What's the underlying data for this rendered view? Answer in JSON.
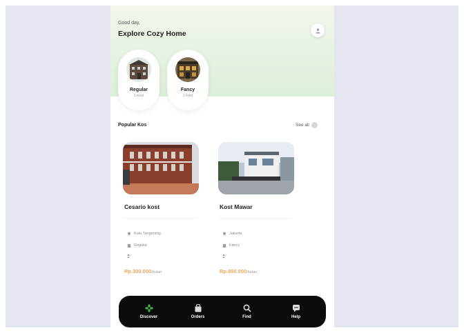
{
  "header": {
    "greeting": "Good day,",
    "title": "Explore Cozy Home"
  },
  "categories": [
    {
      "name": "Regular",
      "count": "1 kost"
    },
    {
      "name": "Fancy",
      "count": "1 kost"
    }
  ],
  "popular": {
    "title": "Popular Kos",
    "see_all": "See all"
  },
  "listings": [
    {
      "name": "Cesario kost",
      "location": "Kota Tangerang",
      "category": "Regular",
      "price": "Rp.300.000",
      "per": "/bulan"
    },
    {
      "name": "Kost Mawar",
      "location": "Jakarta",
      "category": "Fancy",
      "price": "Rp.850.000",
      "per": "/bulan"
    }
  ],
  "nav": [
    {
      "label": "Discover",
      "icon": "compass-icon",
      "active": true
    },
    {
      "label": "Orders",
      "icon": "bag-icon",
      "active": false
    },
    {
      "label": "Find",
      "icon": "search-icon",
      "active": false
    },
    {
      "label": "Help",
      "icon": "chat-icon",
      "active": false
    }
  ],
  "colors": {
    "accent_green": "#3fb950",
    "price_orange": "#f2a65a",
    "nav_bg": "#0c0c0c",
    "hero_green": "#dcefd9"
  }
}
